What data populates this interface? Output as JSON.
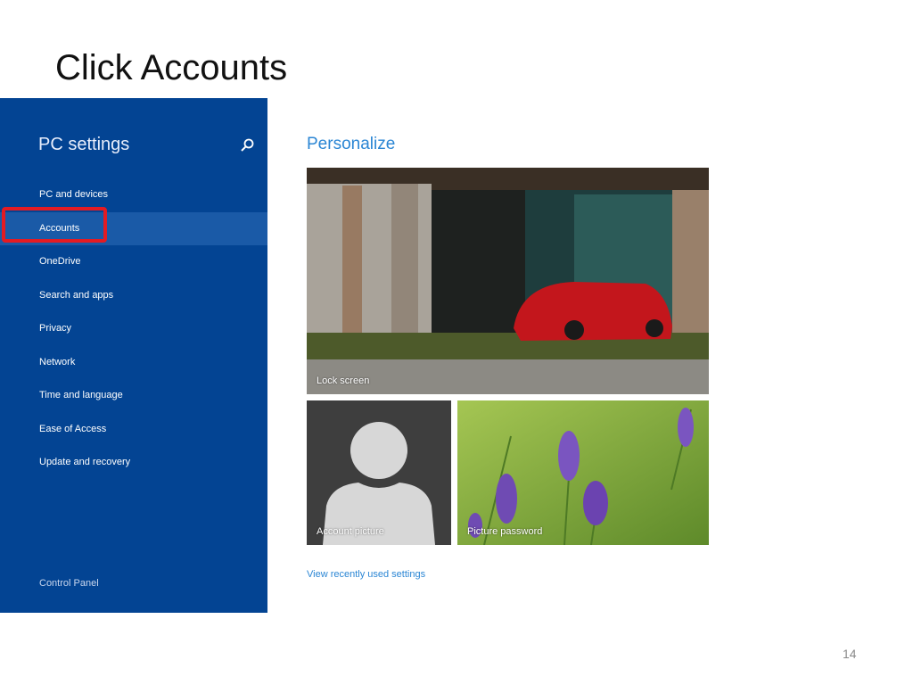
{
  "slide": {
    "title": "Click Accounts",
    "page_number": "14"
  },
  "sidebar": {
    "title": "PC settings",
    "search_icon": "search-icon",
    "items": [
      {
        "label": "PC and devices"
      },
      {
        "label": "Accounts",
        "active": true
      },
      {
        "label": "OneDrive"
      },
      {
        "label": "Search and apps"
      },
      {
        "label": "Privacy"
      },
      {
        "label": "Network"
      },
      {
        "label": "Time and language"
      },
      {
        "label": "Ease of Access"
      },
      {
        "label": "Update and recovery"
      }
    ],
    "footer_link": "Control Panel"
  },
  "main": {
    "section_title": "Personalize",
    "tiles": [
      {
        "label": "Lock screen"
      },
      {
        "label": "Account picture"
      },
      {
        "label": "Picture password"
      }
    ],
    "recent_link": "View recently used settings"
  },
  "colors": {
    "sidebar_bg": "#034493",
    "accent": "#2b86d4",
    "highlight": "#e31b23"
  }
}
